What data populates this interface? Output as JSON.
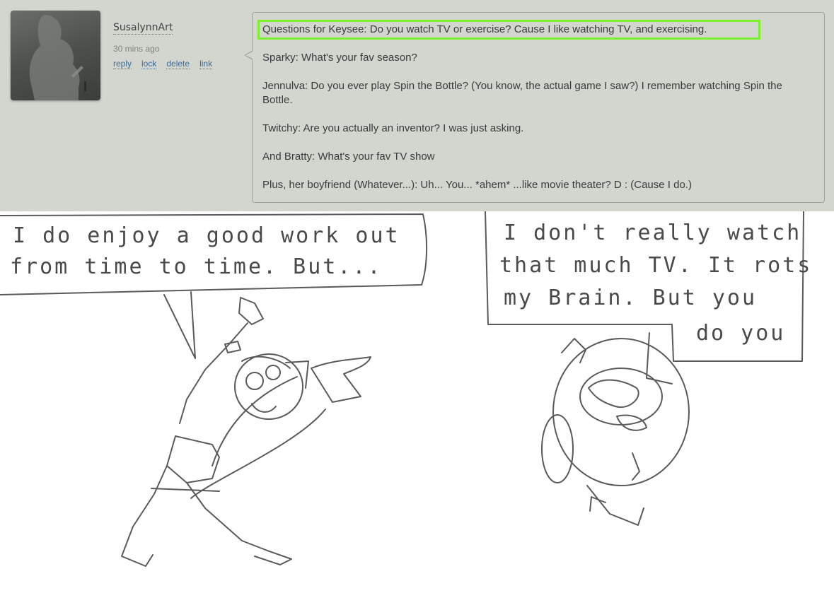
{
  "comment": {
    "username": "SusalynnArt",
    "timestamp": "30 mins ago",
    "actions": [
      "reply",
      "lock",
      "delete",
      "link"
    ],
    "lines": [
      "Questions for Keysee: Do you watch TV or exercise? Cause I like watching TV, and exercising.",
      "Sparky: What's your fav season?",
      "Jennulva: Do you ever play Spin the Bottle? (You know, the actual game I saw?) I remember watching Spin the Bottle.",
      "Twitchy: Are you actually an inventor? I was just asking.",
      "And Bratty: What's your fav TV show",
      "Plus, her boyfriend (Whatever...): Uh... You... *ahem* ...like movie theater? D : (Cause I do.)"
    ]
  },
  "comic": {
    "left_bubble": [
      "I do enjoy a good work out",
      "from time to time. But..."
    ],
    "right_bubble": [
      "I don't really watch",
      "that much TV. It rots",
      "my Brain. But you",
      "do you"
    ]
  },
  "colors": {
    "panel_bg": "#d3d6cf",
    "link": "#3e6a96",
    "highlight_border": "#7cf22a",
    "text": "#363c3b"
  }
}
